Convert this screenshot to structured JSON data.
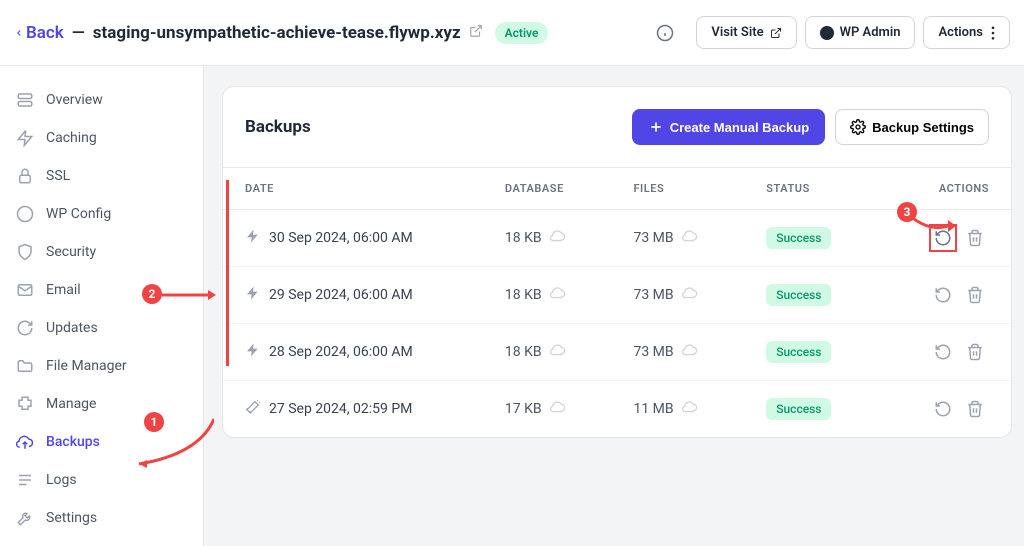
{
  "header": {
    "back_label": "Back",
    "site_name": "staging-unsympathetic-achieve-tease.flywp.xyz",
    "status": "Active",
    "visit_site": "Visit Site",
    "wp_admin": "WP Admin",
    "actions": "Actions"
  },
  "sidebar": {
    "items": [
      {
        "label": "Overview"
      },
      {
        "label": "Caching"
      },
      {
        "label": "SSL"
      },
      {
        "label": "WP Config"
      },
      {
        "label": "Security"
      },
      {
        "label": "Email"
      },
      {
        "label": "Updates"
      },
      {
        "label": "File Manager"
      },
      {
        "label": "Manage"
      },
      {
        "label": "Backups"
      },
      {
        "label": "Logs"
      },
      {
        "label": "Settings"
      }
    ]
  },
  "panel": {
    "title": "Backups",
    "create_label": "Create Manual Backup",
    "settings_label": "Backup Settings",
    "columns": {
      "date": "DATE",
      "database": "DATABASE",
      "files": "FILES",
      "status": "STATUS",
      "actions": "ACTIONS"
    },
    "rows": [
      {
        "date": "30 Sep 2024, 06:00 AM",
        "db": "18 KB",
        "files": "73 MB",
        "status": "Success",
        "type": "auto"
      },
      {
        "date": "29 Sep 2024, 06:00 AM",
        "db": "18 KB",
        "files": "73 MB",
        "status": "Success",
        "type": "auto"
      },
      {
        "date": "28 Sep 2024, 06:00 AM",
        "db": "18 KB",
        "files": "73 MB",
        "status": "Success",
        "type": "auto"
      },
      {
        "date": "27 Sep 2024, 02:59 PM",
        "db": "17 KB",
        "files": "11 MB",
        "status": "Success",
        "type": "manual"
      }
    ]
  },
  "annotations": [
    "1",
    "2",
    "3"
  ]
}
